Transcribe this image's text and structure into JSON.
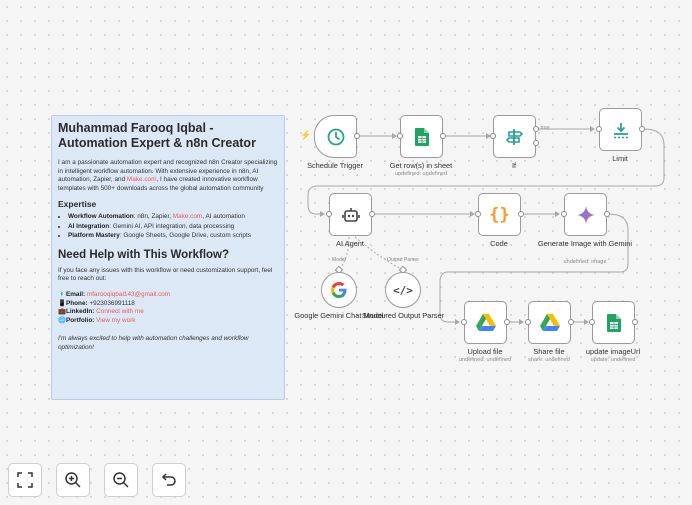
{
  "note": {
    "title": "Muhammad Farooq Iqbal - Automation Expert & n8n Creator",
    "intro_a": "I am a passionate automation expert and recognized n8n Creator specializing in intelligent workflow automation. With extensive experience in n8n, AI automation, Zapier, and ",
    "intro_link": "Make.com",
    "intro_b": ", I have created innovative workflow templates with 500+ downloads across the global automation community",
    "expertise_heading": "Expertise",
    "expertise": [
      {
        "label": "Workflow Automation",
        "pre": ": n8n, Zapier, ",
        "link": "Make.com",
        "post": ", AI automation"
      },
      {
        "label": "AI Integration",
        "pre": ": Gemini AI, API integration, data processing",
        "link": "",
        "post": ""
      },
      {
        "label": "Platform Mastery",
        "pre": ": Google Sheets, Google Drive, custom scripts",
        "link": "",
        "post": ""
      }
    ],
    "help_heading": "Need Help with This Workflow?",
    "help_text": "If you face any issues with this workflow or need customization support, feel free to reach out:",
    "contacts": [
      {
        "icon": "📧",
        "label": "Email",
        "value": "mfarooqiqbal143@gmail.com"
      },
      {
        "icon": "📱",
        "label": "Phone",
        "value": "+923036991118",
        "plain": true
      },
      {
        "icon": "💼",
        "label": "LinkedIn",
        "value": "Connect with me"
      },
      {
        "icon": "🌐",
        "label": "Portfolio",
        "value": "View my work"
      }
    ],
    "closing": "I'm always excited to help with automation challenges and workflow optimization!"
  },
  "nodes": {
    "schedule": {
      "label": "Schedule Trigger",
      "icon": "clock-icon"
    },
    "getrows": {
      "label": "Get row(s) in sheet",
      "sub": "undefined: undefined",
      "icon": "google-sheets-icon"
    },
    "if": {
      "label": "If",
      "icon": "signpost-icon",
      "true_label": "true"
    },
    "limit": {
      "label": "Limit",
      "icon": "limit-icon"
    },
    "agent": {
      "label": "AI Agent",
      "icon": "robot-icon"
    },
    "code": {
      "label": "Code",
      "icon": "braces-icon"
    },
    "genimage": {
      "label": "Generate Image with Gemini",
      "sub": "undefined: image",
      "icon": "gemini-icon"
    },
    "gemini_model": {
      "label": "Google Gemini Chat Model",
      "icon": "google-icon",
      "port_label": "Model"
    },
    "parser": {
      "label": "Structured Output Parser",
      "icon": "code-brackets-icon",
      "port_label": "Output Parser"
    },
    "upload": {
      "label": "Upload file",
      "sub": "undefined: undefined",
      "icon": "google-drive-icon"
    },
    "share": {
      "label": "Share file",
      "sub": "share: undefined",
      "icon": "google-drive-icon"
    },
    "update": {
      "label": "update imageUrl",
      "sub": "update: undefined",
      "icon": "google-sheets-icon"
    }
  },
  "toolbar": [
    "fit-view-icon",
    "zoom-in-icon",
    "zoom-out-icon",
    "undo-icon"
  ],
  "colors": {
    "accent": "#ff6d5a",
    "note_bg": "#dce8f6",
    "sheets_green": "#1fa463",
    "code_orange": "#ff9922"
  }
}
